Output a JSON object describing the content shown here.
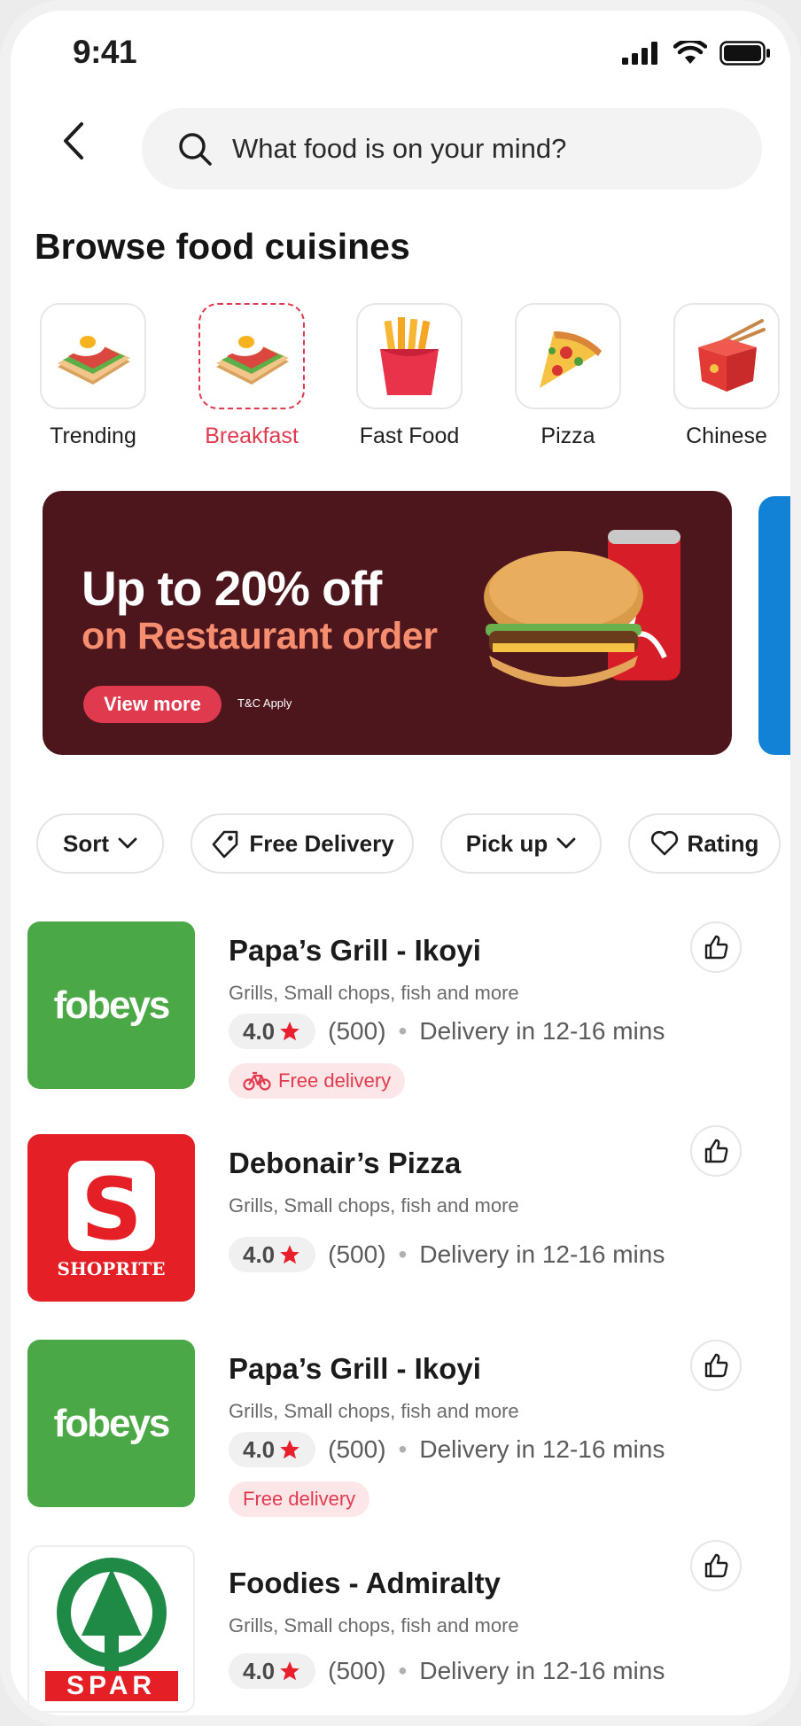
{
  "status": {
    "time": "9:41"
  },
  "search": {
    "placeholder": "What food is on your mind?"
  },
  "section_title": "Browse food cuisines",
  "cuisines": [
    {
      "label": "Trending",
      "active": false
    },
    {
      "label": "Breakfast",
      "active": true
    },
    {
      "label": "Fast Food",
      "active": false
    },
    {
      "label": "Pizza",
      "active": false
    },
    {
      "label": "Chinese",
      "active": false
    }
  ],
  "banner": {
    "headline": "Up to 20% off",
    "subheadline": "on Restaurant order",
    "button": "View more",
    "terms": "T&C Apply"
  },
  "filters": [
    {
      "label": "Sort",
      "icon": "chevron-down-icon"
    },
    {
      "label": "Free Delivery",
      "icon": "delivery-tag-icon"
    },
    {
      "label": "Pick up",
      "icon": "chevron-down-icon"
    },
    {
      "label": "Rating",
      "icon": "heart-icon"
    }
  ],
  "restaurants": [
    {
      "logo": "fobeys",
      "name": "Papa’s Grill - Ikoyi",
      "desc": "Grills, Small chops, fish and more",
      "rating": "4.0",
      "reviews": "(500)",
      "delivery": "Delivery in 12-16 mins",
      "free_delivery": "Free delivery"
    },
    {
      "logo": "SHOPRITE",
      "name": "Debonair’s Pizza",
      "desc": "Grills, Small chops, fish and more",
      "rating": "4.0",
      "reviews": "(500)",
      "delivery": "Delivery in 12-16 mins"
    },
    {
      "logo": "fobeys",
      "name": "Papa’s Grill - Ikoyi",
      "desc": "Grills, Small chops, fish and more",
      "rating": "4.0",
      "reviews": "(500)",
      "delivery": "Delivery in 12-16 mins",
      "free_delivery": "Free delivery"
    },
    {
      "logo": "SPAR",
      "name": "Foodies - Admiralty",
      "desc": "Grills, Small chops, fish and more",
      "rating": "4.0",
      "reviews": "(500)",
      "delivery": "Delivery in 12-16 mins"
    }
  ],
  "colors": {
    "accent": "#e03a4f",
    "banner_bg": "#4d161d",
    "banner_sub": "#f58d6e",
    "fobeys_green": "#4ba846",
    "shoprite_red": "#e41f26"
  }
}
